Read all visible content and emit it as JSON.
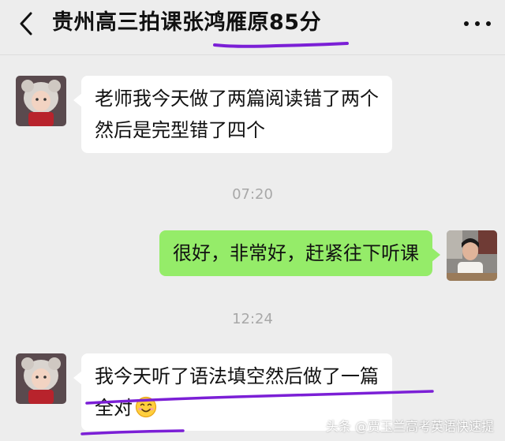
{
  "header": {
    "title": "贵州高三拍课张鸿雁原85分",
    "back_icon": "chevron-left-icon",
    "more_icon": "more-dots-icon"
  },
  "messages": [
    {
      "side": "in",
      "lines": [
        "老师我今天做了两篇阅读错了两个",
        "然后是完型错了四个"
      ]
    },
    {
      "side": "time",
      "text": "07:20"
    },
    {
      "side": "out",
      "lines": [
        "很好，非常好，赶紧往下听课"
      ]
    },
    {
      "side": "time",
      "text": "12:24"
    },
    {
      "side": "in",
      "lines": [
        "我今天听了语法填空然后做了一篇",
        "全对"
      ],
      "emoji": "smiling-face-emoji"
    }
  ],
  "watermark": "头条 @贾玉兰高考英语快速提",
  "colors": {
    "background": "#ededed",
    "outgoing_bubble": "#95ec69",
    "incoming_bubble": "#ffffff",
    "annotation": "#7b1fd6"
  }
}
